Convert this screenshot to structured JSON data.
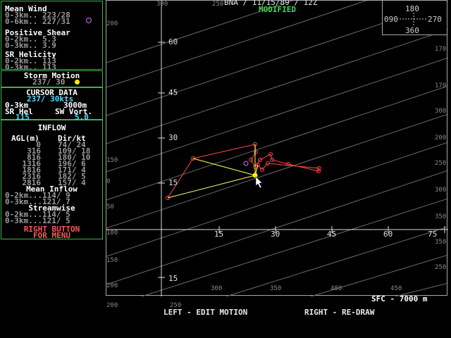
{
  "mean_wind": {
    "title": "Mean Wind",
    "row1": "0-3km.. 223/28",
    "row2": "0-6km.. 227/31"
  },
  "positive_shear": {
    "title": "Positive Shear",
    "row1": "0-2km.. 5.3",
    "row2": "0-3km.. 3.9"
  },
  "sr_helicity": {
    "title": "SR Helicity",
    "row1": "0-2km.. 113",
    "row2": "0-3km.. 113"
  },
  "storm_motion": {
    "title": "Storm Motion",
    "value": "237/ 30"
  },
  "cursor_data": {
    "title": "CURSOR DATA",
    "value": "237/ 30kts",
    "layer_label": "0-3km",
    "layer_value": "3000m",
    "sr_hel_label": "SR Hel",
    "sw_vort_label": "SW Vort.",
    "sr_hel_value": "115",
    "sw_vort_value": "5.0"
  },
  "inflow": {
    "title": "INFLOW",
    "col_agl": "AGL(m)",
    "col_dir": "Dir/kt",
    "rows": [
      {
        "agl": "0",
        "dir": "74/ 24"
      },
      {
        "agl": "316",
        "dir": "109/ 18"
      },
      {
        "agl": "816",
        "dir": "180/ 10"
      },
      {
        "agl": "1316",
        "dir": "196/ 6"
      },
      {
        "agl": "1816",
        "dir": "171/ 4"
      },
      {
        "agl": "2316",
        "dir": "182/ 5"
      },
      {
        "agl": "2816",
        "dir": "157/ 4"
      }
    ],
    "mean_title": "Mean Inflow",
    "mean_row1": "0-2km...114/ 9",
    "mean_row2": "0-3km...121/ 7",
    "stream_title": "Streamwise",
    "stream_row1": "0-2km...114/ 5",
    "stream_row2": "0-3km...121/ 5"
  },
  "menu_hint": {
    "line1": "RIGHT BUTTON",
    "line2": "FOR MENU"
  },
  "header": {
    "title": "BNA / 11/15/89 / 12Z",
    "status": "MODIFIED"
  },
  "compass": {
    "north": "180",
    "west": "090",
    "east": "270",
    "south": "360"
  },
  "footer": {
    "left": "LEFT - EDIT MOTION",
    "right": "RIGHT - RE-DRAW"
  },
  "layer_label": "SFC - 7000 m",
  "grid": {
    "speed_top": [
      "60",
      "45",
      "30",
      "15"
    ],
    "speed_bottom": [
      "15"
    ],
    "speed_axis": [
      "15",
      "30",
      "45",
      "60",
      "75"
    ],
    "dir_labels": [
      "300",
      "250",
      "200",
      "250",
      "300",
      "350",
      "400",
      "450",
      "350",
      "300",
      "250",
      "200",
      "170",
      "300",
      "350",
      "250",
      "200",
      "170",
      "100",
      "150",
      "200",
      "150",
      "50",
      "0",
      "300"
    ]
  },
  "colors": {
    "hodograph": "#ff4444",
    "inflow": "#ffff66",
    "storm": "#ffee00",
    "panel_border": "#3fb34f"
  }
}
